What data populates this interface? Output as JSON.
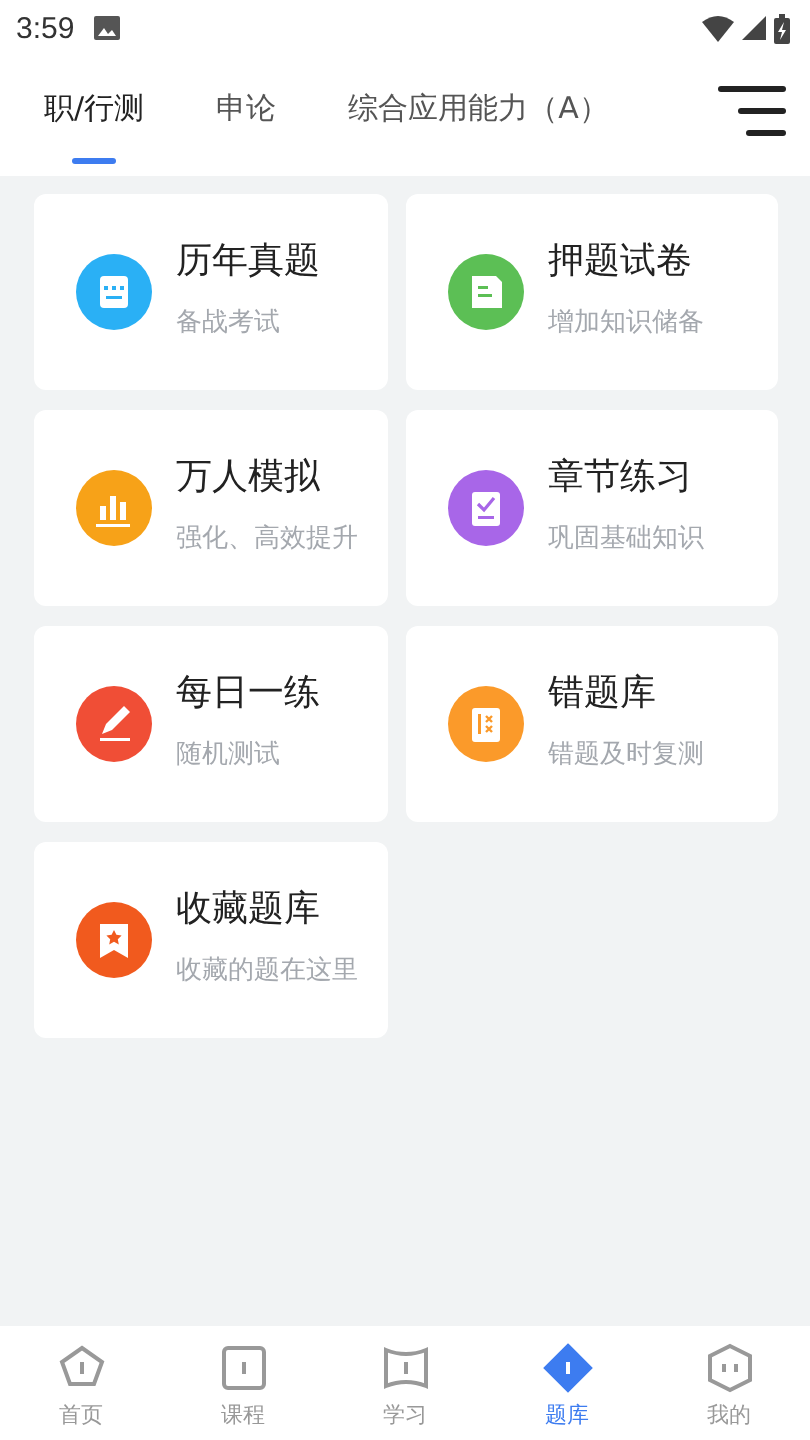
{
  "status_bar": {
    "time": "3:59"
  },
  "tabs": [
    {
      "label": "职/行测",
      "selected": true
    },
    {
      "label": "申论",
      "selected": false
    },
    {
      "label": "综合应用能力（A）",
      "selected": false
    }
  ],
  "cards": [
    {
      "title": "历年真题",
      "subtitle": "备战考试",
      "color": "#2ab0f5",
      "kind": "calendar"
    },
    {
      "title": "押题试卷",
      "subtitle": "增加知识储备",
      "color": "#5cbf55",
      "kind": "document"
    },
    {
      "title": "万人模拟",
      "subtitle": "强化、高效提升",
      "color": "#f7a218",
      "kind": "chart"
    },
    {
      "title": "章节练习",
      "subtitle": "巩固基础知识",
      "color": "#a866e8",
      "kind": "checklist"
    },
    {
      "title": "每日一练",
      "subtitle": "随机测试",
      "color": "#f04e36",
      "kind": "pencil"
    },
    {
      "title": "错题库",
      "subtitle": "错题及时复测",
      "color": "#fb9a2a",
      "kind": "wrong"
    },
    {
      "title": "收藏题库",
      "subtitle": "收藏的题在这里",
      "color": "#f15a1e",
      "kind": "bookmark"
    }
  ],
  "bottom_nav": [
    {
      "label": "首页",
      "kind": "home",
      "selected": false
    },
    {
      "label": "课程",
      "kind": "course",
      "selected": false
    },
    {
      "label": "学习",
      "kind": "study",
      "selected": false
    },
    {
      "label": "题库",
      "kind": "bank",
      "selected": true
    },
    {
      "label": "我的",
      "kind": "me",
      "selected": false
    }
  ]
}
